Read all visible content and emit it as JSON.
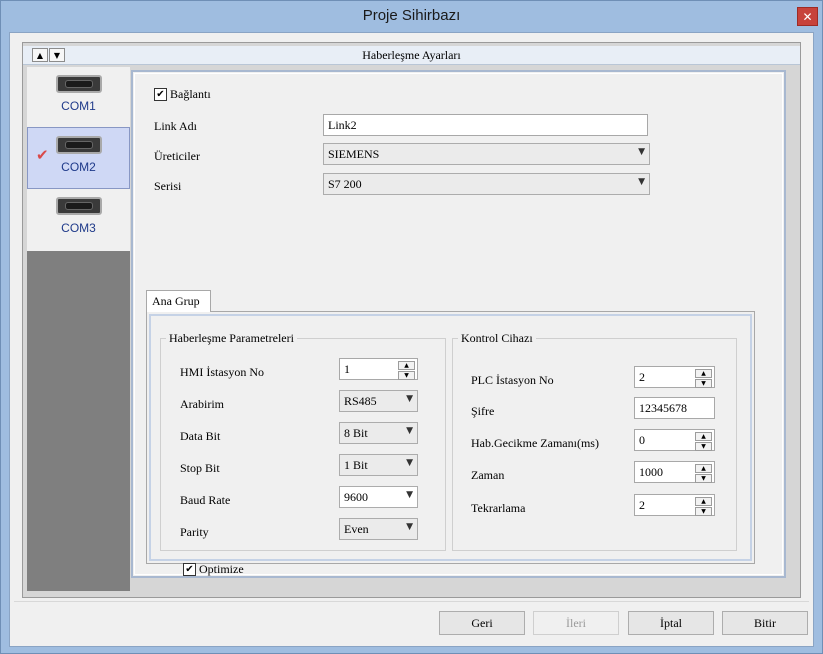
{
  "window": {
    "title": "Proje Sihirbazı",
    "close_glyph": "✕"
  },
  "header": {
    "title": "Haberleşme Ayarları",
    "up_glyph": "▲",
    "down_glyph": "▼"
  },
  "com_ports": [
    {
      "label": "COM1",
      "icon": "serial-port-icon",
      "selected": false
    },
    {
      "label": "COM2",
      "icon": "serial-port-icon",
      "selected": true,
      "check_glyph": "✔"
    },
    {
      "label": "COM3",
      "icon": "serial-port-icon",
      "selected": false
    }
  ],
  "connection": {
    "checkbox_label": "Bağlantı",
    "checked": true,
    "check_glyph": "✔",
    "link_name_label": "Link Adı",
    "link_name_value": "Link2",
    "manufacturer_label": "Üreticiler",
    "manufacturer_value": "SIEMENS",
    "series_label": "Serisi",
    "series_value": "S7 200",
    "dropdown_glyph": "▼"
  },
  "tabs": [
    {
      "label": "Ana Grup"
    }
  ],
  "comm_params": {
    "title": "Haberleşme Parametreleri",
    "hmi_station_label": "HMI İstasyon No",
    "hmi_station_value": "1",
    "interface_label": "Arabirim",
    "interface_value": "RS485",
    "data_bit_label": "Data Bit",
    "data_bit_value": "8 Bit",
    "stop_bit_label": "Stop Bit",
    "stop_bit_value": "1 Bit",
    "baud_rate_label": "Baud Rate",
    "baud_rate_value": "9600",
    "parity_label": "Parity",
    "parity_value": "Even"
  },
  "control_device": {
    "title": "Kontrol Cihazı",
    "plc_station_label": "PLC İstasyon No",
    "plc_station_value": "2",
    "password_label": "Şifre",
    "password_value": "12345678",
    "comm_delay_label": "Hab.Gecikme Zamanı(ms)",
    "comm_delay_value": "0",
    "time_label": "Zaman",
    "time_value": "1000",
    "retry_label": "Tekrarlama",
    "retry_value": "2"
  },
  "optimize": {
    "label": "Optimize",
    "checked": true,
    "check_glyph": "✔"
  },
  "spin_glyphs": {
    "up": "▲",
    "down": "▼"
  },
  "buttons": {
    "back": "Geri",
    "next": "İleri",
    "cancel": "İptal",
    "finish": "Bitir"
  }
}
